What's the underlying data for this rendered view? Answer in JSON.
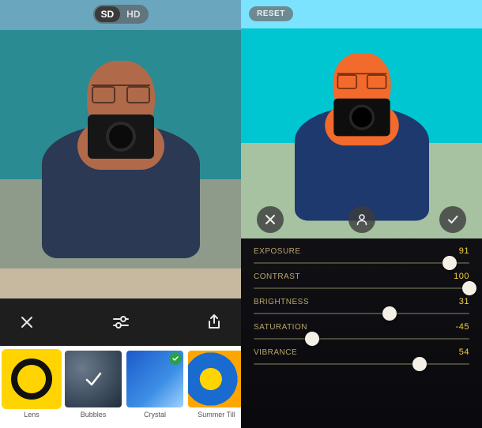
{
  "left": {
    "quality": {
      "sd": "SD",
      "hd": "HD",
      "active": "SD"
    },
    "filters": [
      {
        "id": "lens",
        "label": "Lens",
        "selected": true,
        "checked": false
      },
      {
        "id": "bubbles",
        "label": "Bubbles",
        "selected": false,
        "checked": true
      },
      {
        "id": "crystal",
        "label": "Crystal",
        "selected": false,
        "checked": true
      },
      {
        "id": "summer",
        "label": "Summer Till",
        "selected": false,
        "checked": false
      }
    ]
  },
  "right": {
    "reset_label": "RESET",
    "sliders": [
      {
        "name": "Exposure",
        "value": 91,
        "pct": 91
      },
      {
        "name": "CONTRAST",
        "value": 100,
        "pct": 100
      },
      {
        "name": "BRIGHTNESS",
        "value": 31,
        "pct": 63
      },
      {
        "name": "SATURATION",
        "value": -45,
        "pct": 27
      },
      {
        "name": "VIBRANCE",
        "value": 54,
        "pct": 77
      }
    ]
  },
  "colors": {
    "accent": "#ffd400",
    "value": "#f4cf3f"
  }
}
